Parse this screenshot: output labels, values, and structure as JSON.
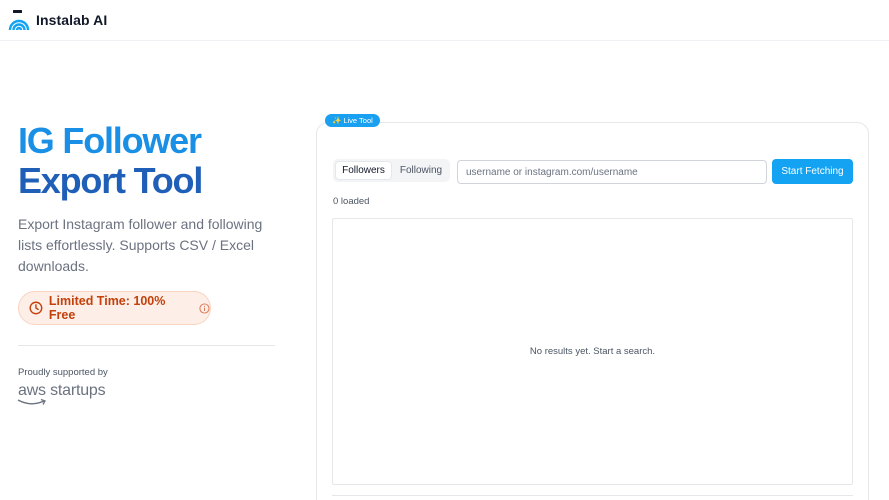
{
  "header": {
    "brand": "Instalab AI",
    "logo_icon": "radar-logo-icon"
  },
  "hero": {
    "title_line1": "IG Follower",
    "title_line2": "Export Tool",
    "description": "Export Instagram follower and following lists effortlessly. Supports CSV / Excel downloads.",
    "badge_text": "Limited Time: 100% Free",
    "supported_label": "Proudly supported by",
    "sponsor_logo_text": "aws startups"
  },
  "tool": {
    "pill_label": "Live Tool",
    "tabs": [
      {
        "label": "Followers",
        "active": true
      },
      {
        "label": "Following",
        "active": false
      }
    ],
    "search_placeholder": "username or instagram.com/username",
    "search_value": "",
    "fetch_label": "Start Fetching",
    "loaded_text": "0 loaded",
    "empty_text": "No results yet. Start a search."
  },
  "colors": {
    "accent": "#13a3f2",
    "title_light": "#1a8fe6",
    "title_dark": "#1f5fb8",
    "badge_bg": "#fdeee7",
    "badge_text": "#c2410c"
  }
}
